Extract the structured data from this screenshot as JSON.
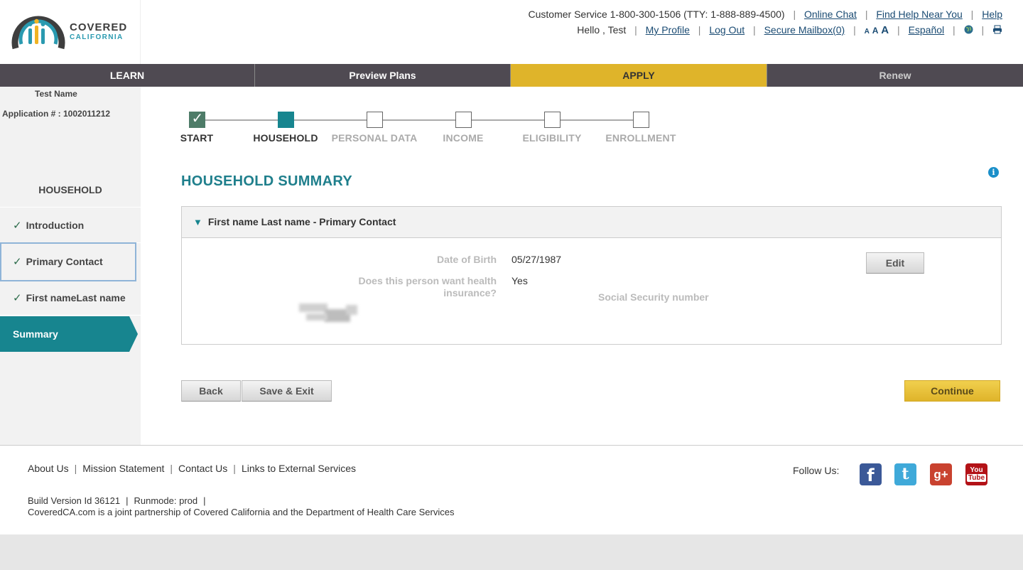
{
  "header": {
    "logo": {
      "word1": "COVERED",
      "word2": "CALIFORNIA"
    },
    "customer_service": "Customer Service 1-800-300-1506 (TTY: 1-888-889-4500)",
    "links_row1": [
      "Online Chat",
      "Find Help Near You",
      "Help"
    ],
    "greeting": "Hello , Test",
    "links_row2": [
      "My Profile",
      "Log Out",
      "Secure Mailbox(0)"
    ],
    "font_sizes": [
      "A",
      "A",
      "A"
    ],
    "language": "Español",
    "icons": [
      "globe-icon",
      "print-icon"
    ]
  },
  "nav": {
    "tabs": [
      "LEARN",
      "Preview Plans",
      "APPLY",
      "Renew"
    ],
    "active": "APPLY"
  },
  "sidebar": {
    "name": "Test Name",
    "application": "Application # : 1002011212",
    "section": "HOUSEHOLD",
    "items": [
      "Introduction",
      "Primary Contact",
      "First nameLast name"
    ],
    "active": "Summary"
  },
  "progress": {
    "steps": [
      "START",
      "HOUSEHOLD",
      "PERSONAL DATA",
      "INCOME",
      "ELIGIBILITY",
      "ENROLLMENT"
    ],
    "completed": 1,
    "current": 2
  },
  "main": {
    "title": "HOUSEHOLD SUMMARY",
    "panel": {
      "header": "First name Last name - Primary Contact",
      "dob_label": "Date of Birth",
      "dob_value": "05/27/1987",
      "wants_label": "Does this person want health insurance?",
      "wants_value": "Yes",
      "ssn_label": "Social Security number",
      "edit": "Edit"
    },
    "buttons": {
      "back": "Back",
      "save_exit": "Save & Exit",
      "continue": "Continue"
    }
  },
  "footer": {
    "links": [
      "About Us",
      "Mission Statement",
      "Contact Us",
      "Links to External Services"
    ],
    "build": "Build Version Id 36121",
    "runmode": "Runmode: prod",
    "partner": "CoveredCA.com is a joint partnership of Covered California and the Department of Health Care Services",
    "follow": "Follow Us:",
    "social_icons": [
      "facebook-icon",
      "twitter-icon",
      "google-plus-icon",
      "youtube-icon"
    ],
    "youtube_text": [
      "You",
      "Tube"
    ]
  },
  "colors": {
    "teal": "#17858f",
    "apply_yellow": "#dfb42a",
    "nav_dark": "#4f4a52",
    "link_blue": "#1a4b73"
  }
}
